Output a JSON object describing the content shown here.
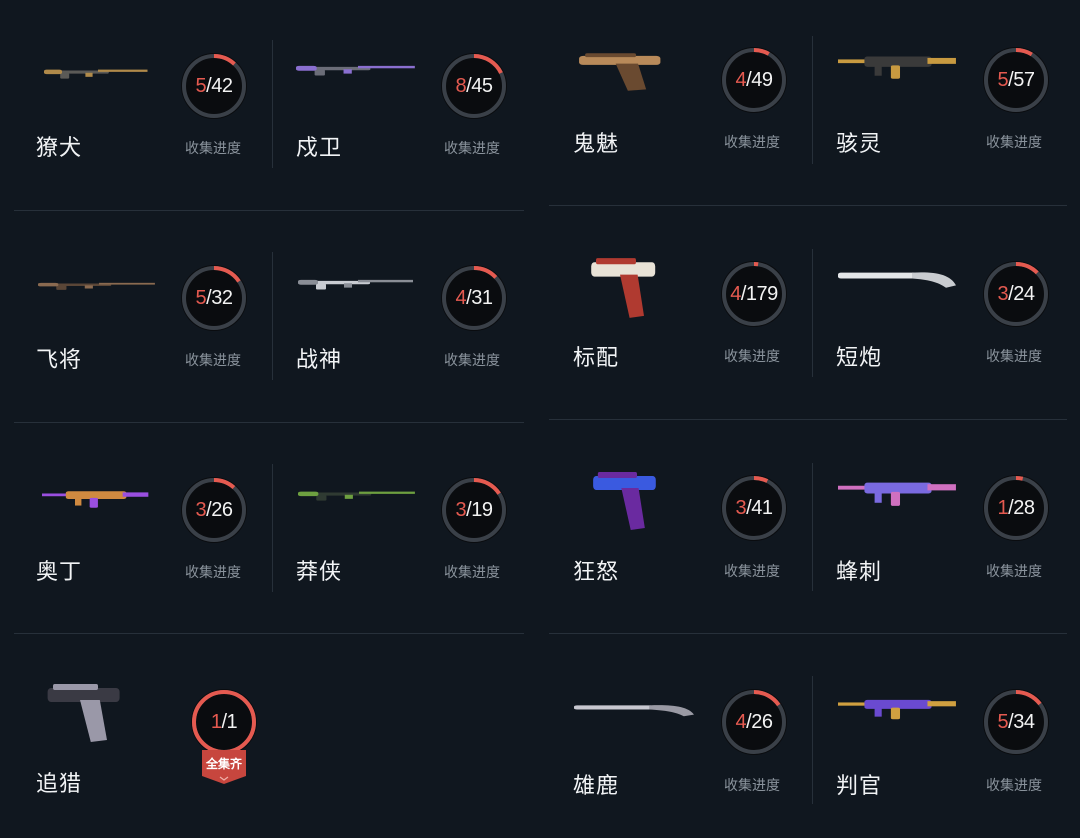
{
  "caption": "收集进度",
  "complete_badge": "全集齐",
  "colors": {
    "accent": "#e55a50",
    "ring_track": "#3a4048",
    "background": "#10171f",
    "badge": "#c7463e"
  },
  "weapons": [
    {
      "name": "獠犬",
      "owned": "5",
      "total": "42",
      "progress": 0.119,
      "icon": "odin-like-rifle-icon"
    },
    {
      "name": "戍卫",
      "owned": "8",
      "total": "45",
      "progress": 0.178,
      "icon": "guardian-rifle-icon"
    },
    {
      "name": "飞将",
      "owned": "5",
      "total": "32",
      "progress": 0.156,
      "icon": "marshal-sniper-icon"
    },
    {
      "name": "战神",
      "owned": "4",
      "total": "31",
      "progress": 0.129,
      "icon": "ares-rifle-icon"
    },
    {
      "name": "奥丁",
      "owned": "3",
      "total": "26",
      "progress": 0.115,
      "icon": "odin-lmg-icon"
    },
    {
      "name": "莽侠",
      "owned": "3",
      "total": "19",
      "progress": 0.158,
      "icon": "outlaw-sniper-icon"
    },
    {
      "name": "追猎",
      "owned": "1",
      "total": "1",
      "progress": 1.0,
      "icon": "hunter-pistol-icon",
      "complete": true
    },
    {
      "name": "鬼魅",
      "owned": "4",
      "total": "49",
      "progress": 0.082,
      "icon": "ghost-pistol-icon"
    },
    {
      "name": "骇灵",
      "owned": "5",
      "total": "57",
      "progress": 0.088,
      "icon": "spectre-smg-icon"
    },
    {
      "name": "标配",
      "owned": "4",
      "total": "179",
      "progress": 0.022,
      "icon": "classic-pistol-icon"
    },
    {
      "name": "短炮",
      "owned": "3",
      "total": "24",
      "progress": 0.125,
      "icon": "shorty-shotgun-icon"
    },
    {
      "name": "狂怒",
      "owned": "3",
      "total": "41",
      "progress": 0.073,
      "icon": "frenzy-pistol-icon"
    },
    {
      "name": "蜂刺",
      "owned": "1",
      "total": "28",
      "progress": 0.036,
      "icon": "stinger-smg-icon"
    },
    {
      "name": "雄鹿",
      "owned": "4",
      "total": "26",
      "progress": 0.154,
      "icon": "bucky-shotgun-icon"
    },
    {
      "name": "判官",
      "owned": "5",
      "total": "34",
      "progress": 0.147,
      "icon": "judge-shotgun-icon"
    }
  ]
}
